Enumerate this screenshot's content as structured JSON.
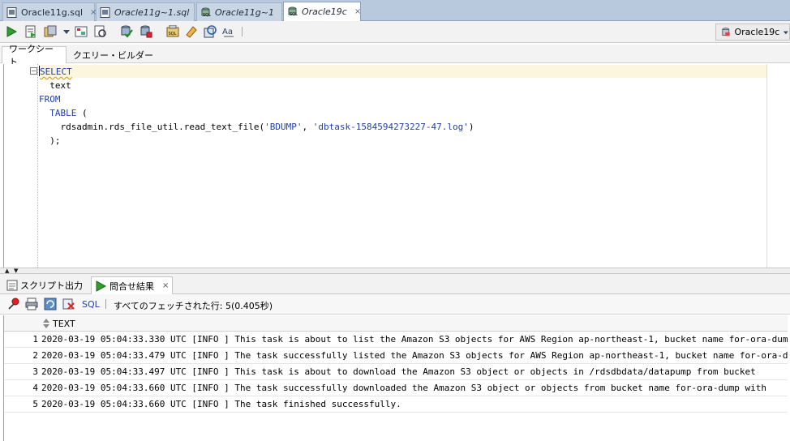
{
  "tabs": [
    {
      "label": "Oracle11g.sql",
      "italic": false,
      "icon": "sql-file-icon"
    },
    {
      "label": "Oracle11g~1.sql",
      "italic": true,
      "icon": "sql-file-icon"
    },
    {
      "label": "Oracle11g~1",
      "italic": true,
      "icon": "db-connection-icon"
    },
    {
      "label": "Oracle19c",
      "italic": true,
      "icon": "db-connection-icon",
      "active": true
    }
  ],
  "toolbar": {
    "connection": "Oracle19c",
    "buttons": [
      "run-statement-icon",
      "run-script-icon",
      "autotrace-icon",
      "explain-plan-icon",
      "sql-tuning-icon",
      "commit-icon",
      "rollback-icon",
      "sql-history-icon",
      "clear-icon",
      "refresh-icon",
      "format-icon"
    ]
  },
  "subtabs": {
    "worksheet": "ワークシート",
    "query_builder": "クエリー・ビルダー"
  },
  "editor": {
    "lines": [
      [
        "SELECT"
      ],
      [
        "  text"
      ],
      [
        "FROM"
      ],
      [
        "  TABLE",
        " ("
      ],
      [
        "    rdsadmin.rds_file_util.read_text_file(",
        "'BDUMP'",
        ", ",
        "'dbtask-1584594273227-47.log'",
        ")"
      ],
      [
        "  );"
      ]
    ]
  },
  "bottom_tabs": {
    "script_output": "スクリプト出力",
    "query_result": "問合せ結果",
    "close": "×"
  },
  "result_toolbar": {
    "sql_label": "SQL",
    "status": "すべてのフェッチされた行: 5(0.405秒)"
  },
  "grid": {
    "column": "TEXT",
    "rows": [
      {
        "n": "1",
        "text": "2020-03-19 05:04:33.330 UTC [INFO ] This task is about to list the Amazon S3 objects for AWS Region ap-northeast-1, bucket name for-ora-dump"
      },
      {
        "n": "2",
        "text": "2020-03-19 05:04:33.479 UTC [INFO ] The task successfully listed the Amazon S3 objects for AWS Region ap-northeast-1, bucket name for-ora-dump"
      },
      {
        "n": "3",
        "text": "2020-03-19 05:04:33.497 UTC [INFO ] This task is about to download the Amazon S3 object or objects in /rdsdbdata/datapump from bucket"
      },
      {
        "n": "4",
        "text": "2020-03-19 05:04:33.660 UTC [INFO ] The task successfully downloaded the Amazon S3 object or objects from bucket name for-ora-dump with"
      },
      {
        "n": "5",
        "text": "2020-03-19 05:04:33.660 UTC [INFO ] The task finished successfully."
      }
    ]
  }
}
